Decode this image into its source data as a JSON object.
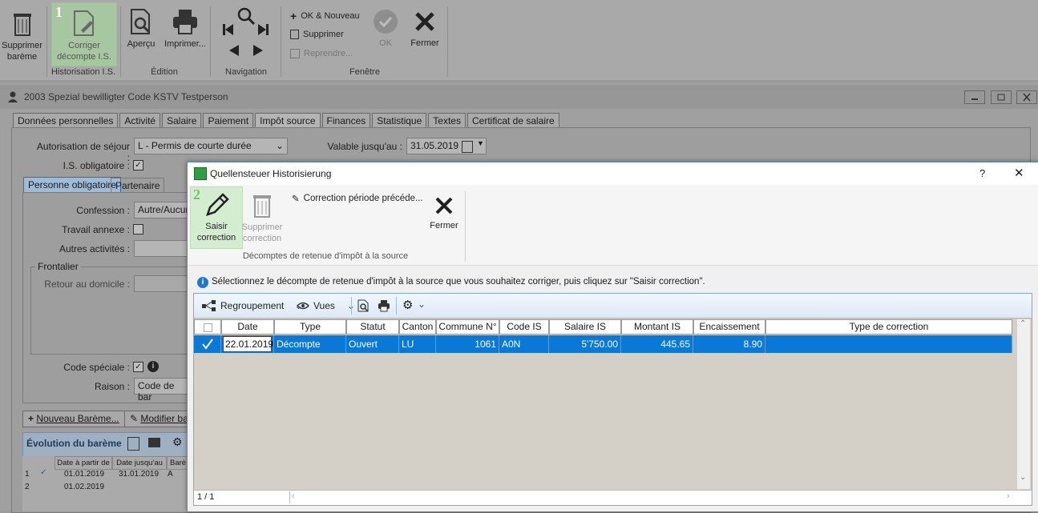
{
  "ribbon": {
    "buttons": [
      {
        "id": "supprimer_bareme",
        "label": "Supprimer barème"
      },
      {
        "id": "corriger_decompte",
        "label": "Corriger décompte I.S."
      },
      {
        "id": "apercu",
        "label": "Aperçu"
      },
      {
        "id": "imprimer",
        "label": "Imprimer..."
      },
      {
        "id": "ok",
        "label": "OK"
      },
      {
        "id": "fermer",
        "label": "Fermer"
      }
    ],
    "small": {
      "ok_nouveau": "OK & Nouveau",
      "supprimer": "Supprimer",
      "reprendre": "Reprendre..."
    },
    "groups": {
      "historisation": "Historisation I.S.",
      "edition": "Édition",
      "navigation": "Navigation",
      "fenetre": "Fenêtre"
    },
    "badge": "1"
  },
  "main": {
    "title": "2003 Spezial bewilligter Code KSTV  Testperson",
    "tabs": [
      "Données personnelles",
      "Activité",
      "Salaire",
      "Paiement",
      "Impôt source",
      "Finances",
      "Statistique",
      "Textes",
      "Certificat de salaire"
    ],
    "active_tab": "Impôt source",
    "fields": {
      "autorisation_label": "Autorisation de séjour :",
      "autorisation_value": "L - Permis de courte durée",
      "valable_label": "Valable jusqu'au :",
      "valable_value": "31.05.2019",
      "is_obligatoire_label": "I.S. obligatoire :",
      "confession_label": "Confession :",
      "confession_value": "Autre/Aucun",
      "travail_annexe_label": "Travail annexe :",
      "autres_activites_label": "Autres activités :",
      "frontalier_label": "Frontalier",
      "retour_label": "Retour au domicile :",
      "code_speciale_label": "Code spéciale :",
      "raison_label": "Raison :",
      "raison_value": "Code de bar"
    },
    "subtabs": [
      "Personne obligatoire",
      "Partenaire"
    ],
    "bottom_buttons": {
      "nouveau": "Nouveau Barème...",
      "modifier": "Modifier ba"
    },
    "evolution": {
      "title": "Évolution du barème",
      "headers": [
        "Date à partir de",
        "Date jusqu'au",
        "Barè"
      ],
      "rows": [
        {
          "n": "1",
          "from": "01.01.2019",
          "to": "31.01.2019",
          "b": "A"
        },
        {
          "n": "2",
          "from": "01.02.2019",
          "to": "",
          "b": ""
        }
      ]
    }
  },
  "dialog": {
    "title": "Quellensteuer Historisierung",
    "help": "?",
    "close": "✕",
    "badge": "2",
    "buttons": {
      "saisir": "Saisir correction",
      "supprimer": "Supprimer correction",
      "correction_precedente": "Correction période précéde...",
      "fermer": "Fermer"
    },
    "group_label": "Décomptes de retenue d'impôt à la source",
    "info": "Sélectionnez le décompte de retenue d'impôt à la source que vous souhaitez corriger, puis cliquez sur \"Saisir correction\".",
    "toolbar": {
      "regroupement": "Regroupement",
      "vues": "Vues"
    },
    "headers": [
      "Date",
      "Type",
      "Statut",
      "Canton",
      "Commune N°",
      "Code IS",
      "Salaire IS",
      "Montant IS",
      "Encaissement IS",
      "Type de correction"
    ],
    "row": {
      "date": "22.01.2019",
      "type": "Décompte",
      "statut": "Ouvert",
      "canton": "LU",
      "commune": "1061",
      "code_is": "A0N",
      "salaire": "5'750.00",
      "montant": "445.65",
      "encaissement": "8.90",
      "type_correction": ""
    },
    "pager": "1 / 1"
  }
}
